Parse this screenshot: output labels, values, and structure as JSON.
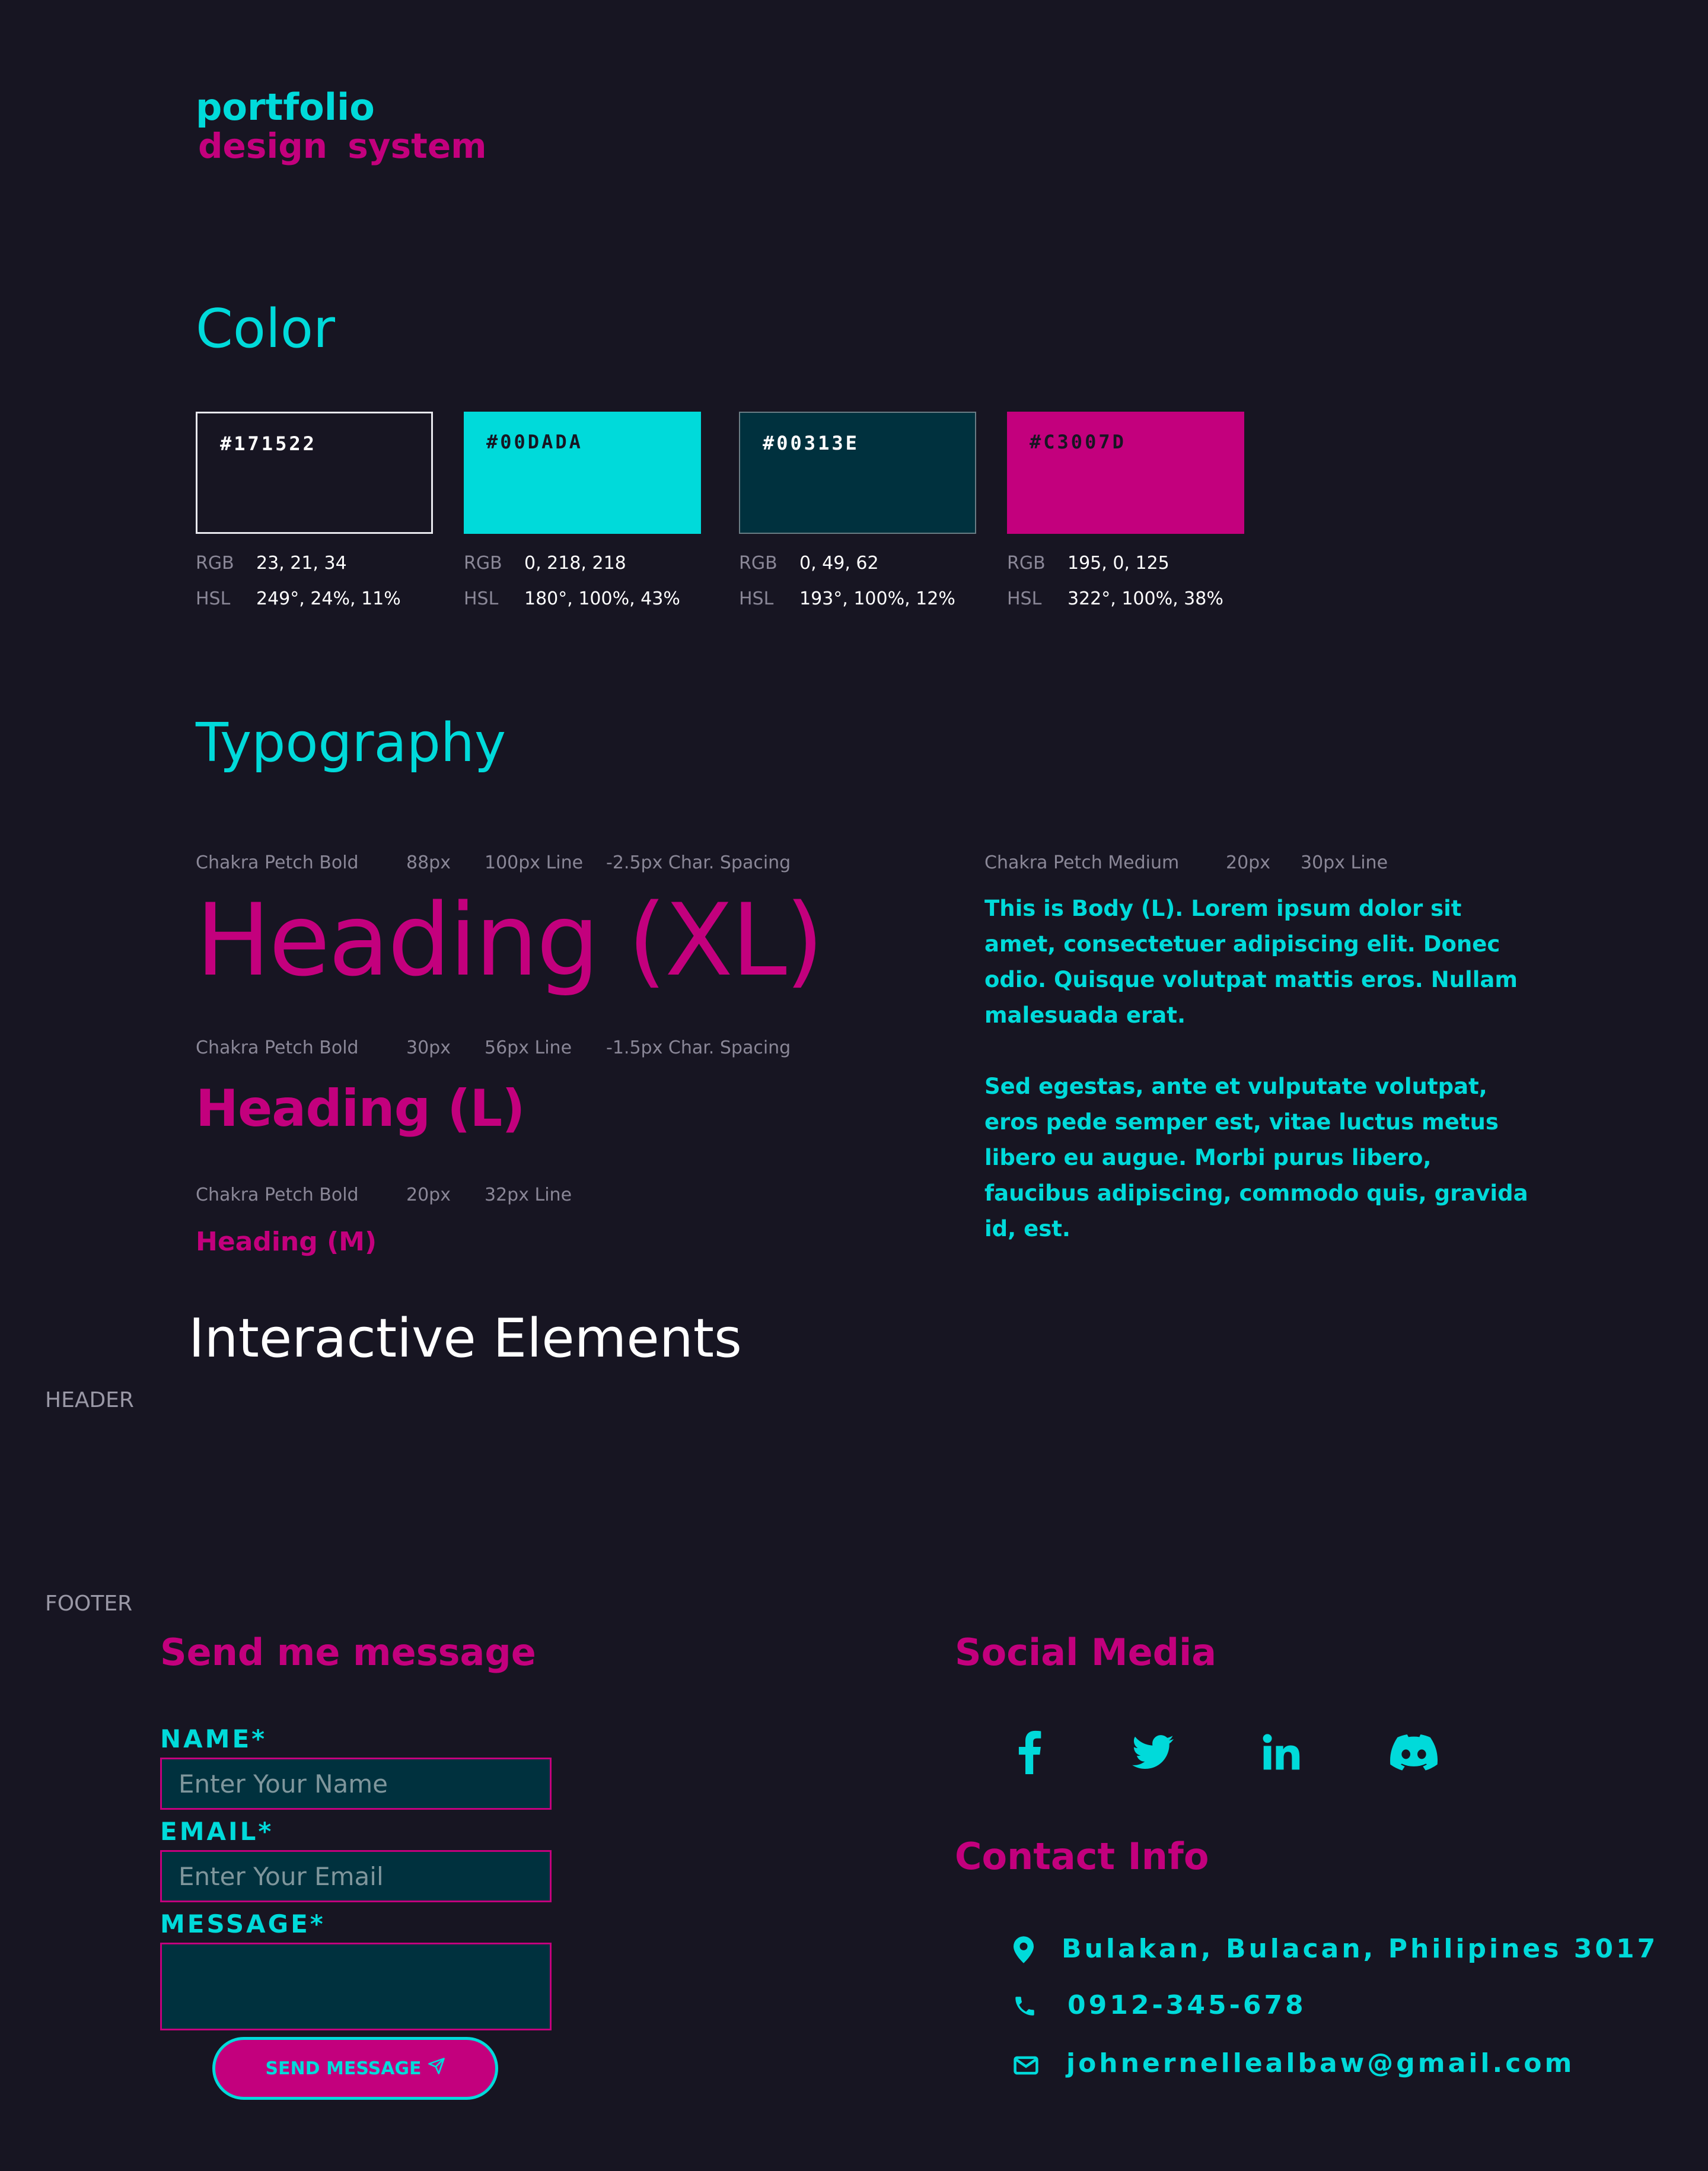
{
  "logo": {
    "line1": "portfolio",
    "line2": "design  system"
  },
  "colors": {
    "title": "Color",
    "label_rgb": "RGB",
    "label_hsl": "HSL",
    "swatches": [
      {
        "hex": "#171522",
        "rgb": "23, 21, 34",
        "hsl": "249°, 24%, 11%"
      },
      {
        "hex": "#00DADA",
        "rgb": "0, 218, 218",
        "hsl": "180°, 100%, 43%"
      },
      {
        "hex": "#00313E",
        "rgb": "0, 49, 62",
        "hsl": "193°, 100%, 12%"
      },
      {
        "hex": "#C3007D",
        "rgb": "195, 0, 125",
        "hsl": "322°, 100%, 38%"
      }
    ]
  },
  "typography": {
    "title": "Typography",
    "xl": {
      "font": "Chakra Petch Bold",
      "size": "88px",
      "line": "100px Line",
      "spacing": "-2.5px Char. Spacing",
      "sample": "Heading (XL)"
    },
    "l": {
      "font": "Chakra Petch Bold",
      "size": "30px",
      "line": "56px Line",
      "spacing": "-1.5px Char. Spacing",
      "sample": "Heading (L)"
    },
    "m": {
      "font": "Chakra Petch Bold",
      "size": "20px",
      "line": "32px Line",
      "sample": "Heading (M)"
    },
    "body": {
      "font": "Chakra Petch  Medium",
      "size": "20px",
      "line": "30px Line",
      "para1": "This is Body (L). Lorem ipsum dolor sit amet, consectetuer adipiscing elit. Donec odio. Quisque volutpat mattis eros. Nullam malesuada erat.",
      "para2": "Sed egestas, ante et vulputate volutpat, eros pede semper est, vitae luctus metus libero eu augue. Morbi purus libero, faucibus adipiscing, commodo quis, gravida id, est."
    }
  },
  "interactive": {
    "title": "Interactive Elements",
    "header_label": "HEADER",
    "footer_label": "FOOTER"
  },
  "form": {
    "title": "Send me message",
    "name_label": "NAME*",
    "name_placeholder": "Enter Your Name",
    "email_label": "EMAIL*",
    "email_placeholder": "Enter Your Email",
    "message_label": "MESSAGE*",
    "send_label": "SEND MESSAGE"
  },
  "social": {
    "title": "Social Media",
    "icons": [
      "facebook-icon",
      "twitter-icon",
      "linkedin-icon",
      "discord-icon"
    ]
  },
  "contact": {
    "title": "Contact Info",
    "address": "Bulakan, Bulacan, Philipines 3017",
    "phone": "0912-345-678",
    "email": "johnernellealbaw@gmail.com"
  },
  "palette": {
    "bg": "#171522",
    "cyan": "#00DADA",
    "dark_teal": "#00313E",
    "magenta": "#C3007D"
  }
}
